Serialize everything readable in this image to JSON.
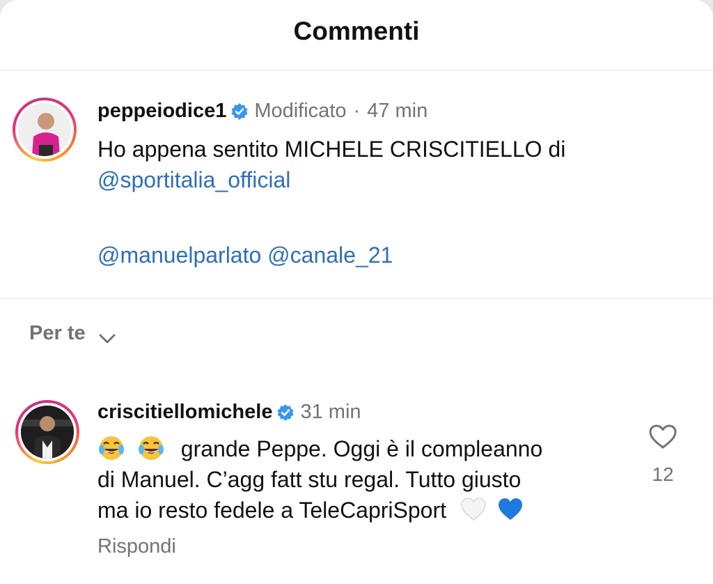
{
  "header": {
    "title": "Commenti"
  },
  "caption": {
    "username": "peppeiodice1",
    "edited_label": "Modificato",
    "separator": "·",
    "time": "47 min",
    "text_line1": "Ho appena sentito MICHELE CRISCITIELLO di",
    "mention1": "@sportitalia_official",
    "mention2": "@manuelparlato",
    "mention3": "@canale_21"
  },
  "sort": {
    "label": "Per te"
  },
  "comment": {
    "username": "criscitiellomichele",
    "time": "31 min",
    "emoji": [
      "😂",
      "😂"
    ],
    "text_line1": "grande Peppe. Oggi è il compleanno",
    "text_line2": "di Manuel. C’agg fatt stu regal. Tutto giusto",
    "text_line3": "ma io resto fedele a TeleCapriSport",
    "hearts": [
      "🤍",
      "💙"
    ],
    "like_count": "12",
    "reply_label": "Rispondi"
  },
  "colors": {
    "verified": "#3797f0",
    "mention": "#2f6fb8",
    "secondary_text": "#737373"
  }
}
